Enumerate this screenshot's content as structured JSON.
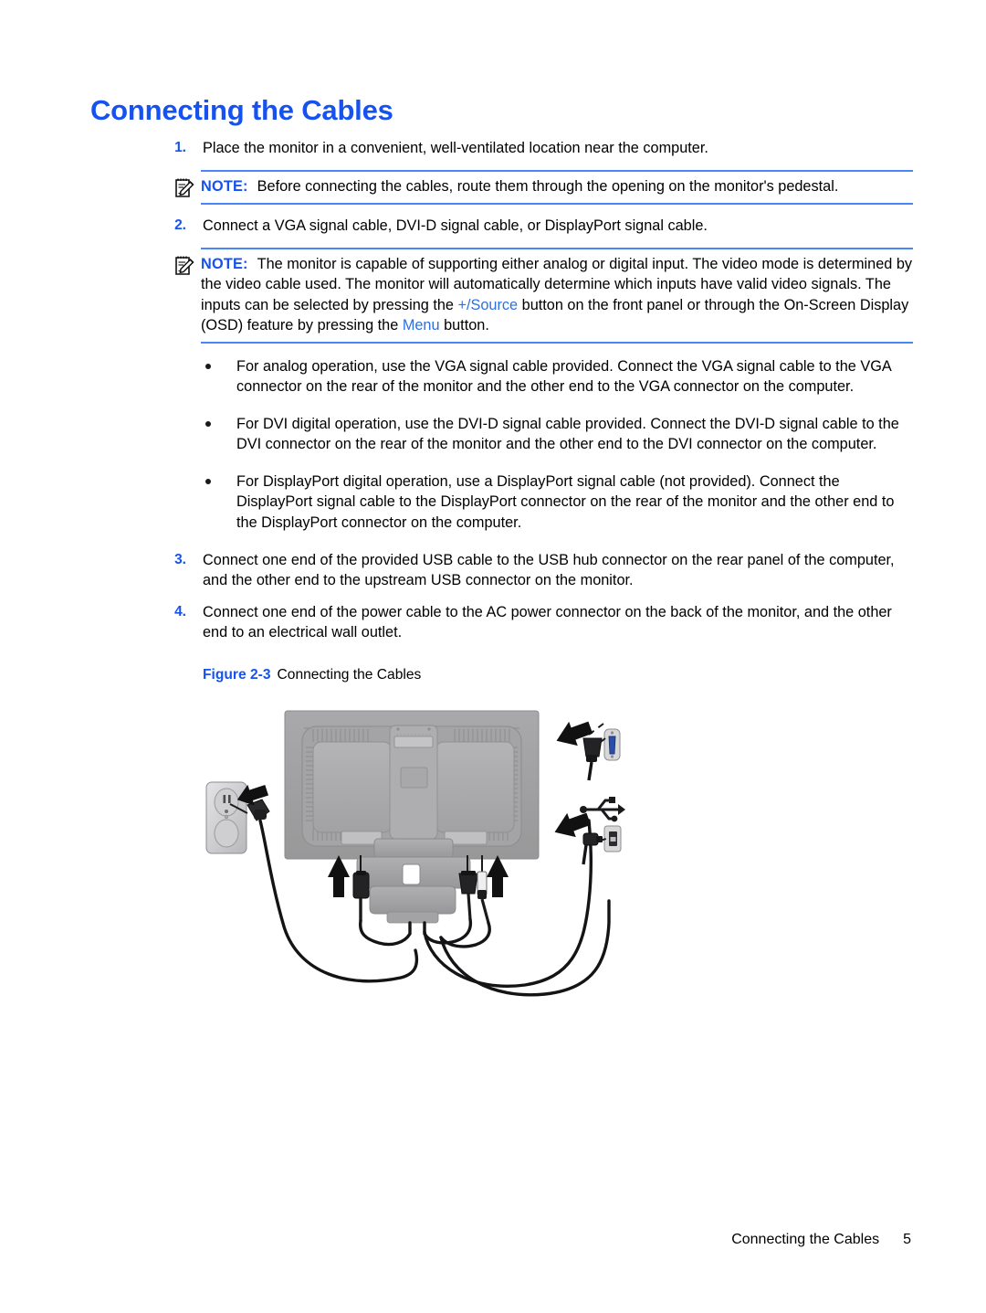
{
  "document": {
    "title": "Connecting the Cables",
    "steps": [
      {
        "number": "1.",
        "text": "Place the monitor in a convenient, well-ventilated location near the computer."
      },
      {
        "number": "2.",
        "text": "Connect a VGA signal cable, DVI-D signal cable, or DisplayPort signal cable."
      },
      {
        "number": "3.",
        "text": "Connect one end of the provided USB cable to the USB hub connector on the rear panel of the computer, and the other end to the upstream USB connector on the monitor."
      },
      {
        "number": "4.",
        "text": "Connect one end of the power cable to the AC power connector on the back of the monitor, and the other end to an electrical wall outlet."
      }
    ],
    "notes": [
      {
        "label": "NOTE:",
        "text": "Before connecting the cables, route them through the opening on the monitor's pedestal."
      },
      {
        "label": "NOTE:",
        "part1": "The monitor is capable of supporting either analog or digital input. The video mode is determined by the video cable used. The monitor will automatically determine which inputs have valid video signals. The inputs can be selected by pressing the ",
        "term1": "+/Source",
        "part2": " button on the front panel or through the On-Screen Display (OSD) feature by pressing the ",
        "term2": "Menu",
        "part3": " button."
      }
    ],
    "bullets": [
      "For analog operation, use the VGA signal cable provided. Connect the VGA signal cable to the VGA connector on the rear of the monitor and the other end to the VGA connector on the computer.",
      "For DVI digital operation, use the DVI-D signal cable provided. Connect the DVI-D signal cable to the DVI connector on the rear of the monitor and the other end to the DVI connector on the computer.",
      "For DisplayPort digital operation, use a DisplayPort signal cable (not provided). Connect the DisplayPort signal cable to the DisplayPort connector on the rear of the monitor and the other end to the DisplayPort connector on the computer."
    ],
    "figure": {
      "number": "Figure 2-3",
      "caption": "Connecting the Cables",
      "elements": {
        "monitor": "monitor-rear-view",
        "wall_outlet": "electrical-wall-outlet",
        "vga_port": "vga-connector-port",
        "usb_symbol": "usb-trident-symbol",
        "usb_port": "usb-connector-port"
      }
    },
    "footer": {
      "label": "Connecting the Cables",
      "page_number": "5"
    },
    "colors": {
      "heading_blue": "#1652f0",
      "rule_blue": "#4a86f7",
      "term_blue": "#2f6fe0",
      "body_black": "#000000"
    }
  }
}
